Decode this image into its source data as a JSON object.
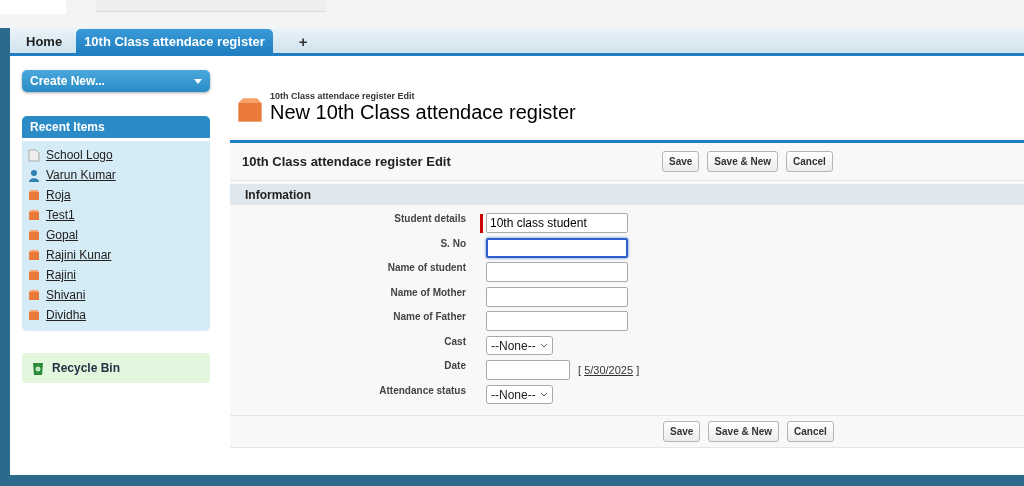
{
  "tabs": [
    {
      "label": "Home",
      "selected": false
    },
    {
      "label": "10th Class attendace register",
      "selected": true
    },
    {
      "label": "+",
      "selected": false
    }
  ],
  "sidebar": {
    "create_new": "Create New...",
    "recent_items": {
      "title": "Recent Items",
      "items": [
        {
          "label": "School Logo",
          "kind": "document"
        },
        {
          "label": "Varun Kumar",
          "kind": "person"
        },
        {
          "label": "Roja",
          "kind": "record"
        },
        {
          "label": "Test1",
          "kind": "record"
        },
        {
          "label": "Gopal",
          "kind": "record"
        },
        {
          "label": "Rajini Kunar",
          "kind": "record"
        },
        {
          "label": "Rajini",
          "kind": "record"
        },
        {
          "label": "Shivani",
          "kind": "record"
        },
        {
          "label": "Dividha",
          "kind": "record"
        }
      ]
    },
    "recycle_bin": "Recycle Bin"
  },
  "page_header": {
    "subtitle": "10th Class attendace register Edit",
    "title": "New 10th Class attendace register"
  },
  "form": {
    "title": "10th Class attendace register Edit",
    "buttons": [
      "Save",
      "Save & New",
      "Cancel"
    ],
    "section": "Information",
    "fields": [
      {
        "label": "Student details",
        "kind": "text",
        "value": "10th class student",
        "required": true,
        "focused": false
      },
      {
        "label": "S. No",
        "kind": "text",
        "required": false,
        "focused": true
      },
      {
        "label": "Name of student",
        "kind": "text",
        "required": false,
        "focused": false
      },
      {
        "label": "Name of Mother",
        "kind": "text",
        "required": false,
        "focused": false
      },
      {
        "label": "Name of Father",
        "kind": "text",
        "required": false,
        "focused": false
      },
      {
        "label": "Cast",
        "kind": "select",
        "value": "--None--",
        "required": false
      },
      {
        "label": "Date",
        "kind": "date",
        "bracket_open": "[",
        "today": "5/30/2025",
        "bracket_close": "]",
        "required": false
      },
      {
        "label": "Attendance status",
        "kind": "select",
        "value": "--None--",
        "required": false
      }
    ],
    "footer_buttons": [
      "Save",
      "Save & New",
      "Cancel"
    ]
  }
}
